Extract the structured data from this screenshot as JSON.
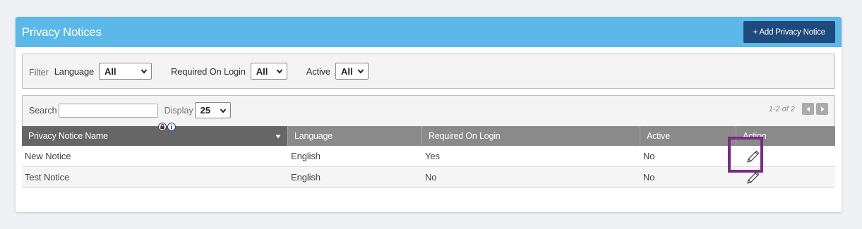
{
  "header": {
    "title": "Privacy Notices",
    "add_button_label": "+ Add Privacy Notice"
  },
  "filter": {
    "label": "Filter",
    "language_label": "Language",
    "language_value": "All",
    "required_label": "Required On Login",
    "required_value": "All",
    "active_label": "Active",
    "active_value": "All"
  },
  "grid": {
    "search_label": "Search",
    "search_value": "",
    "display_label": "Display",
    "display_value": "25",
    "pager_text": "1-2 of 2",
    "columns": [
      "Privacy Notice Name",
      "Language",
      "Required On Login",
      "Active",
      "Action"
    ],
    "rows": [
      {
        "name": "New Notice",
        "language": "English",
        "required": "Yes",
        "active": "No"
      },
      {
        "name": "Test Notice",
        "language": "English",
        "required": "No",
        "active": "No"
      }
    ]
  },
  "colors": {
    "header_bg": "#5bb8e8",
    "add_button_bg": "#1f4a7d",
    "table_header_bg": "#8a8a8a",
    "highlight": "#7b2b86"
  },
  "icons": [
    "chevron-down-icon",
    "sort-down-icon",
    "lock-icon",
    "info-icon",
    "prev-page-icon",
    "next-page-icon",
    "edit-pencil-icon"
  ]
}
